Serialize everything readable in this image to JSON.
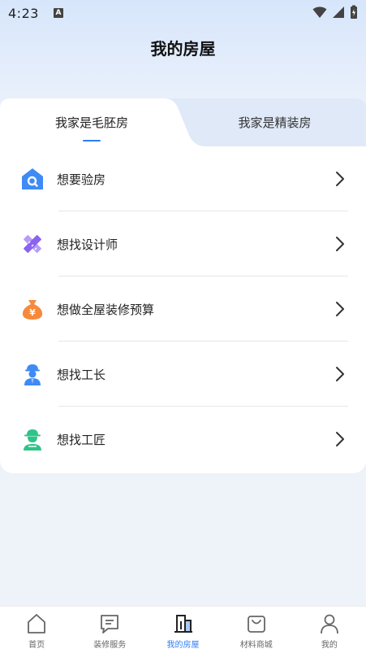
{
  "status_bar": {
    "time": "4:23",
    "notification_badge": "A"
  },
  "header": {
    "title": "我的房屋"
  },
  "tabs": [
    {
      "label": "我家是毛胚房",
      "active": true
    },
    {
      "label": "我家是精装房",
      "active": false
    }
  ],
  "list": {
    "items": [
      {
        "label": "想要验房",
        "icon": "house-search-icon",
        "color": "#3f8af5"
      },
      {
        "label": "想找设计师",
        "icon": "pencil-ruler-icon",
        "color": "#8a63f0"
      },
      {
        "label": "想做全屋装修预算",
        "icon": "money-bag-icon",
        "color": "#f68a3c"
      },
      {
        "label": "想找工长",
        "icon": "foreman-icon",
        "color": "#3f8af5"
      },
      {
        "label": "想找工匠",
        "icon": "craftsman-icon",
        "color": "#2fc38a"
      }
    ]
  },
  "bottom_nav": {
    "items": [
      {
        "label": "首页",
        "icon": "home-icon",
        "active": false
      },
      {
        "label": "装修服务",
        "icon": "chat-service-icon",
        "active": false
      },
      {
        "label": "我的房屋",
        "icon": "building-icon",
        "active": true
      },
      {
        "label": "材料商城",
        "icon": "shopping-bag-icon",
        "active": false
      },
      {
        "label": "我的",
        "icon": "user-icon",
        "active": false
      }
    ]
  },
  "colors": {
    "accent": "#2f7cf6",
    "background": "#eef2f9"
  }
}
